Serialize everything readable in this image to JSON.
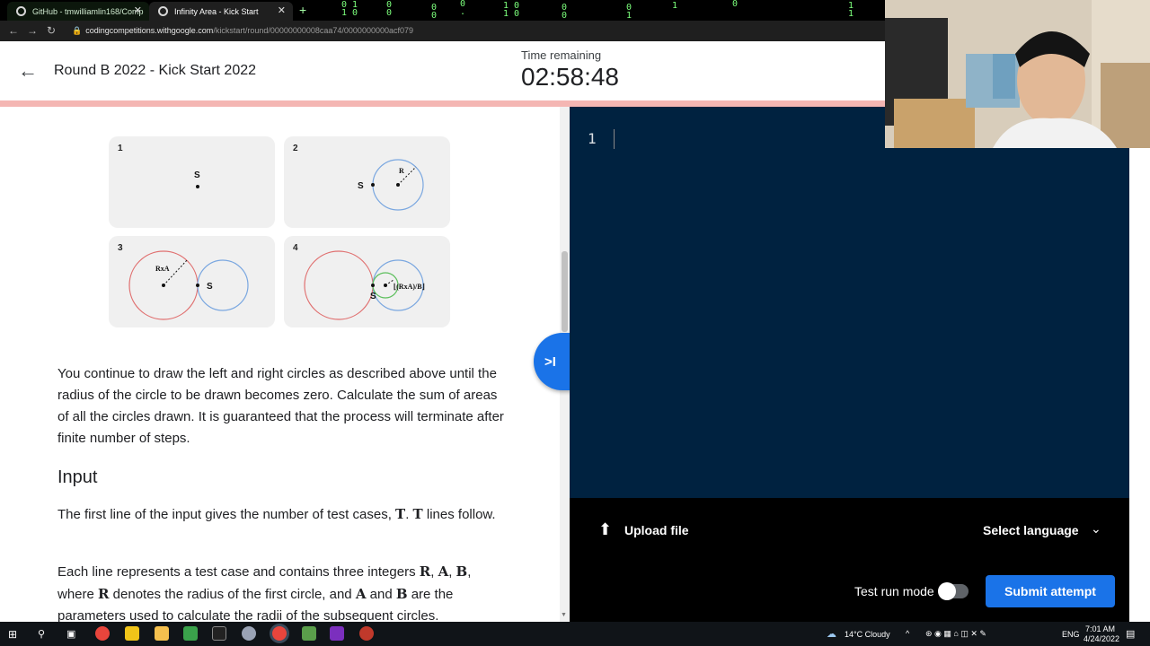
{
  "browser": {
    "tabs": [
      {
        "title": "GitHub - tmwilliamlin168/Comp"
      },
      {
        "title": "Infinity Area - Kick Start"
      }
    ],
    "url_host": "codingcompetitions.withgoogle.com",
    "url_path": "/kickstart/round/00000000008caa74/0000000000acf079"
  },
  "header": {
    "title": "Round B 2022 - Kick Start 2022",
    "time_label": "Time remaining",
    "time_value": "02:58:48"
  },
  "figure": {
    "panels": [
      {
        "number": "1",
        "labels": [
          "S"
        ]
      },
      {
        "number": "2",
        "labels": [
          "S",
          "R"
        ]
      },
      {
        "number": "3",
        "labels": [
          "RxA",
          "S"
        ]
      },
      {
        "number": "4",
        "labels": [
          "S",
          "⌊(RxA)/B⌋"
        ]
      }
    ]
  },
  "problem": {
    "para1": "You continue to draw the left and right circles as described above until the radius of the circle to be drawn becomes zero. Calculate the sum of areas of all the circles drawn. It is guaranteed that the process will terminate after finite number of steps.",
    "input_heading": "Input",
    "para2_a": "The first line of the input gives the number of test cases, ",
    "var_T": "T",
    "para2_b": ". ",
    "para2_c": " lines follow.",
    "para3_a": "Each line represents a test case and contains three integers ",
    "var_R": "R",
    "var_A": "A",
    "var_B": "B",
    "para3_b": ", where ",
    "para3_c": " denotes the radius of the first circle, and ",
    "para3_d": " and ",
    "para3_e": " are the parameters used to calculate the radii of the subsequent circles.",
    "comma": ", "
  },
  "editor": {
    "line_number": "1",
    "content": ""
  },
  "footer": {
    "upload_label": "Upload file",
    "select_language": "Select language",
    "test_run_label": "Test run mode",
    "test_run_on": false,
    "submit_label": "Submit attempt"
  },
  "taskbar": {
    "weather": "14°C  Cloudy",
    "lang": "ENG",
    "time": "7:01 AM",
    "date": "4/24/2022"
  },
  "colors": {
    "editor_bg": "#002240",
    "accent": "#1a73e8",
    "progress": "#f4b6b3"
  }
}
